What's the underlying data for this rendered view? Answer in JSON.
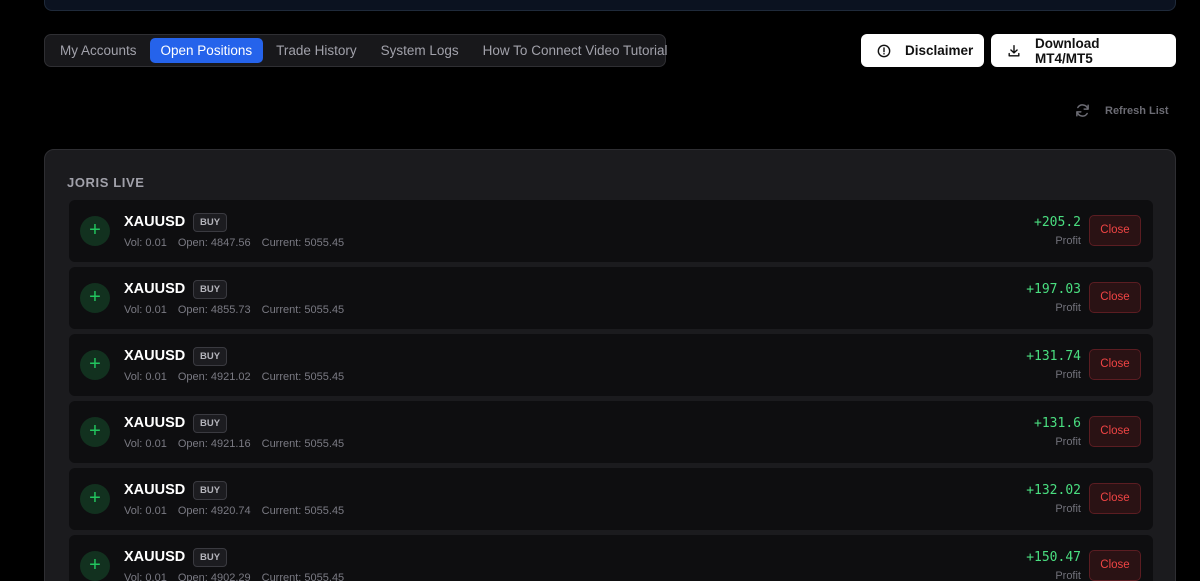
{
  "tabs": [
    {
      "label": "My Accounts",
      "active": false
    },
    {
      "label": "Open Positions",
      "active": true
    },
    {
      "label": "Trade History",
      "active": false
    },
    {
      "label": "System Logs",
      "active": false
    },
    {
      "label": "How To Connect Video Tutorial",
      "active": false
    }
  ],
  "actions": {
    "disclaimer_label": "Disclaimer",
    "download_label": "Download MT4/MT5",
    "refresh_label": "Refresh List"
  },
  "account": {
    "title": "JORIS LIVE",
    "positions": [
      {
        "symbol": "XAUUSD",
        "side": "BUY",
        "vol": "Vol: 0.01",
        "open": "Open: 4847.56",
        "current": "Current: 5055.45",
        "profit": "+205.2",
        "profit_label": "Profit",
        "close_label": "Close"
      },
      {
        "symbol": "XAUUSD",
        "side": "BUY",
        "vol": "Vol: 0.01",
        "open": "Open: 4855.73",
        "current": "Current: 5055.45",
        "profit": "+197.03",
        "profit_label": "Profit",
        "close_label": "Close"
      },
      {
        "symbol": "XAUUSD",
        "side": "BUY",
        "vol": "Vol: 0.01",
        "open": "Open: 4921.02",
        "current": "Current: 5055.45",
        "profit": "+131.74",
        "profit_label": "Profit",
        "close_label": "Close"
      },
      {
        "symbol": "XAUUSD",
        "side": "BUY",
        "vol": "Vol: 0.01",
        "open": "Open: 4921.16",
        "current": "Current: 5055.45",
        "profit": "+131.6",
        "profit_label": "Profit",
        "close_label": "Close"
      },
      {
        "symbol": "XAUUSD",
        "side": "BUY",
        "vol": "Vol: 0.01",
        "open": "Open: 4920.74",
        "current": "Current: 5055.45",
        "profit": "+132.02",
        "profit_label": "Profit",
        "close_label": "Close"
      },
      {
        "symbol": "XAUUSD",
        "side": "BUY",
        "vol": "Vol: 0.01",
        "open": "Open: 4902.29",
        "current": "Current: 5055.45",
        "profit": "+150.47",
        "profit_label": "Profit",
        "close_label": "Close"
      }
    ]
  },
  "icons": {
    "plus_symbol": "+",
    "disclaimer": "alert-circle-icon",
    "download": "download-icon",
    "refresh": "refresh-icon"
  },
  "colors": {
    "accent": "#2563eb",
    "profit": "#4ade80",
    "close": "#ef4444"
  }
}
